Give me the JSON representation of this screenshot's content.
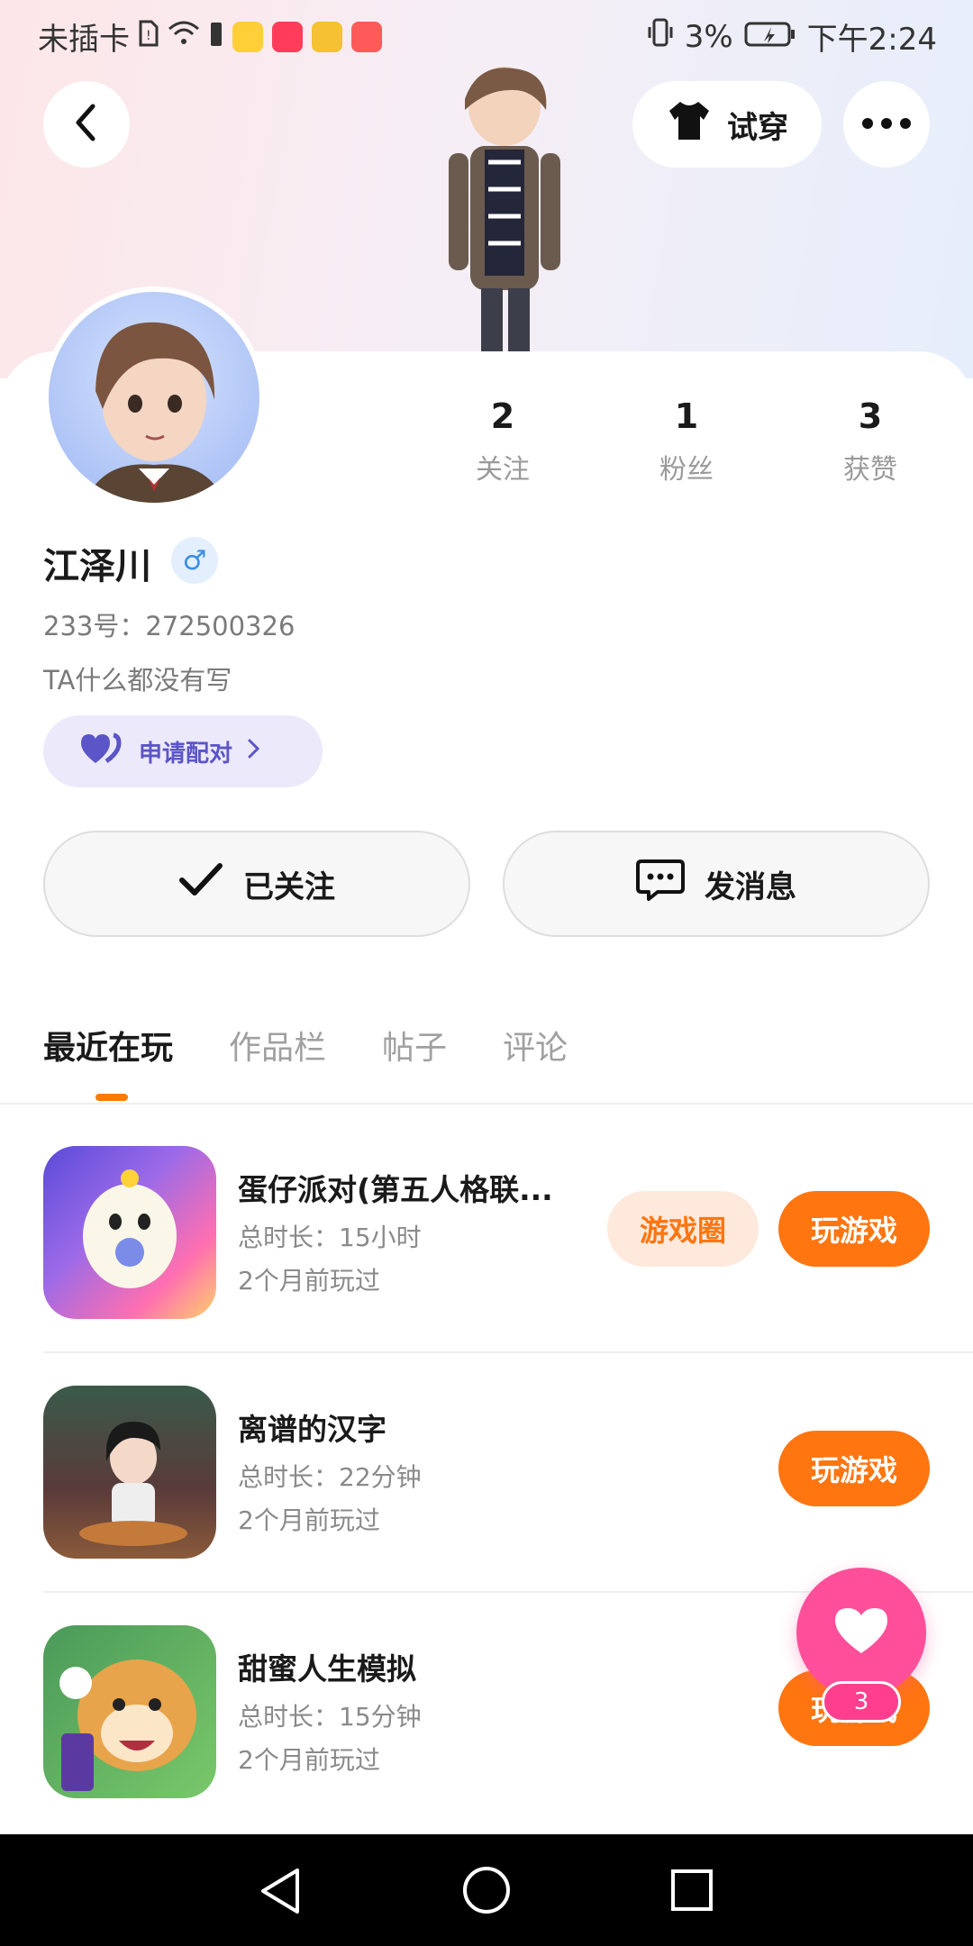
{
  "status_bar": {
    "carrier": "未插卡",
    "battery": "3%",
    "time": "下午2:24"
  },
  "header": {
    "tryon_label": "试穿"
  },
  "profile": {
    "stats": [
      {
        "value": "2",
        "label": "关注"
      },
      {
        "value": "1",
        "label": "粉丝"
      },
      {
        "value": "3",
        "label": "获赞"
      }
    ],
    "name": "江泽川",
    "gender_symbol": "♂",
    "id_line": "233号：272500326",
    "bio": "TA什么都没有写",
    "pair_label": "申请配对"
  },
  "actions": {
    "followed_label": "已关注",
    "message_label": "发消息"
  },
  "tabs": [
    {
      "label": "最近在玩"
    },
    {
      "label": "作品栏"
    },
    {
      "label": "帖子"
    },
    {
      "label": "评论"
    }
  ],
  "games": [
    {
      "name": "蛋仔派对(第五人格联...",
      "duration": "总时长：15小时",
      "last_played": "2个月前玩过",
      "circle_label": "游戏圈",
      "play_label": "玩游戏"
    },
    {
      "name": "离谱的汉字",
      "duration": "总时长：22分钟",
      "last_played": "2个月前玩过",
      "play_label": "玩游戏"
    },
    {
      "name": "甜蜜人生模拟",
      "duration": "总时长：15分钟",
      "last_played": "2个月前玩过",
      "play_label": "玩游戏"
    }
  ],
  "fab": {
    "badge": "3"
  },
  "colors": {
    "accent": "#ff7510",
    "pink": "#ff4f9a",
    "pair_purple": "#5b55c8"
  }
}
